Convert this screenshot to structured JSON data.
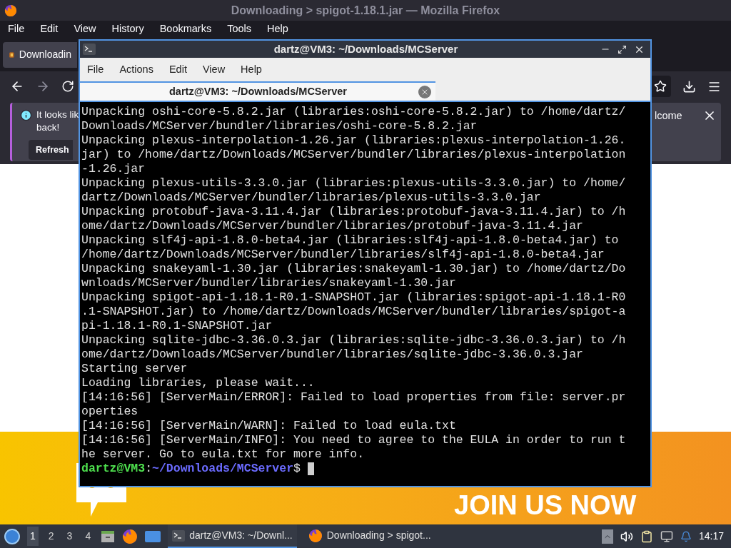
{
  "firefox": {
    "title": "Downloading > spigot-1.18.1.jar — Mozilla Firefox",
    "menu": [
      "File",
      "Edit",
      "View",
      "History",
      "Bookmarks",
      "Tools",
      "Help"
    ],
    "tab": {
      "title": "Downloadin"
    },
    "notification": {
      "lines": [
        "It looks lik",
        "back!"
      ],
      "trailing": "lcome",
      "button": "Refresh"
    },
    "banner": {
      "slogan": "JOIN US NOW"
    }
  },
  "terminal": {
    "title": "dartz@VM3: ~/Downloads/MCServer",
    "menu": [
      "File",
      "Actions",
      "Edit",
      "View",
      "Help"
    ],
    "tabs": [
      {
        "title": "dartz@VM3: ~/Downloads/MCServer",
        "selected": true
      }
    ],
    "lines": [
      {
        "kind": "output",
        "text": "Unpacking oshi-core-5.8.2.jar (libraries:oshi-core-5.8.2.jar) to /home/dartz/"
      },
      {
        "kind": "output",
        "text": "Downloads/MCServer/bundler/libraries/oshi-core-5.8.2.jar"
      },
      {
        "kind": "output",
        "text": "Unpacking plexus-interpolation-1.26.jar (libraries:plexus-interpolation-1.26."
      },
      {
        "kind": "output",
        "text": "jar) to /home/dartz/Downloads/MCServer/bundler/libraries/plexus-interpolation"
      },
      {
        "kind": "output",
        "text": "-1.26.jar"
      },
      {
        "kind": "output",
        "text": "Unpacking plexus-utils-3.3.0.jar (libraries:plexus-utils-3.3.0.jar) to /home/"
      },
      {
        "kind": "output",
        "text": "dartz/Downloads/MCServer/bundler/libraries/plexus-utils-3.3.0.jar"
      },
      {
        "kind": "output",
        "text": "Unpacking protobuf-java-3.11.4.jar (libraries:protobuf-java-3.11.4.jar) to /h"
      },
      {
        "kind": "output",
        "text": "ome/dartz/Downloads/MCServer/bundler/libraries/protobuf-java-3.11.4.jar"
      },
      {
        "kind": "output",
        "text": "Unpacking slf4j-api-1.8.0-beta4.jar (libraries:slf4j-api-1.8.0-beta4.jar) to"
      },
      {
        "kind": "output",
        "text": "/home/dartz/Downloads/MCServer/bundler/libraries/slf4j-api-1.8.0-beta4.jar"
      },
      {
        "kind": "output",
        "text": "Unpacking snakeyaml-1.30.jar (libraries:snakeyaml-1.30.jar) to /home/dartz/Do"
      },
      {
        "kind": "output",
        "text": "wnloads/MCServer/bundler/libraries/snakeyaml-1.30.jar"
      },
      {
        "kind": "output",
        "text": "Unpacking spigot-api-1.18.1-R0.1-SNAPSHOT.jar (libraries:spigot-api-1.18.1-R0"
      },
      {
        "kind": "output",
        "text": ".1-SNAPSHOT.jar) to /home/dartz/Downloads/MCServer/bundler/libraries/spigot-a"
      },
      {
        "kind": "output",
        "text": "pi-1.18.1-R0.1-SNAPSHOT.jar"
      },
      {
        "kind": "output",
        "text": "Unpacking sqlite-jdbc-3.36.0.3.jar (libraries:sqlite-jdbc-3.36.0.3.jar) to /h"
      },
      {
        "kind": "output",
        "text": "ome/dartz/Downloads/MCServer/bundler/libraries/sqlite-jdbc-3.36.0.3.jar"
      },
      {
        "kind": "output",
        "text": "Starting server"
      },
      {
        "kind": "output",
        "text": "Loading libraries, please wait..."
      },
      {
        "kind": "output",
        "text": "[14:16:56] [ServerMain/ERROR]: Failed to load properties from file: server.pr"
      },
      {
        "kind": "output",
        "text": "operties"
      },
      {
        "kind": "output",
        "text": "[14:16:56] [ServerMain/WARN]: Failed to load eula.txt"
      },
      {
        "kind": "output",
        "text": "[14:16:56] [ServerMain/INFO]: You need to agree to the EULA in order to run t"
      },
      {
        "kind": "output",
        "text": "he server. Go to eula.txt for more info."
      },
      {
        "kind": "prompt",
        "user": "dartz@VM3",
        "separator": ":",
        "path": "~/Downloads/MCServer",
        "symbol": "$"
      }
    ]
  },
  "taskbar": {
    "workspaces": [
      {
        "label": "1",
        "selected": true
      },
      {
        "label": "2",
        "selected": false
      },
      {
        "label": "3",
        "selected": false
      },
      {
        "label": "4",
        "selected": false
      }
    ],
    "tasks": [
      {
        "kind": "terminal",
        "label": "dartz@VM3: ~/Downl...",
        "selected": true
      },
      {
        "kind": "browser",
        "label": "Downloading > spigot...",
        "selected": false
      }
    ],
    "clock": "14:17"
  }
}
